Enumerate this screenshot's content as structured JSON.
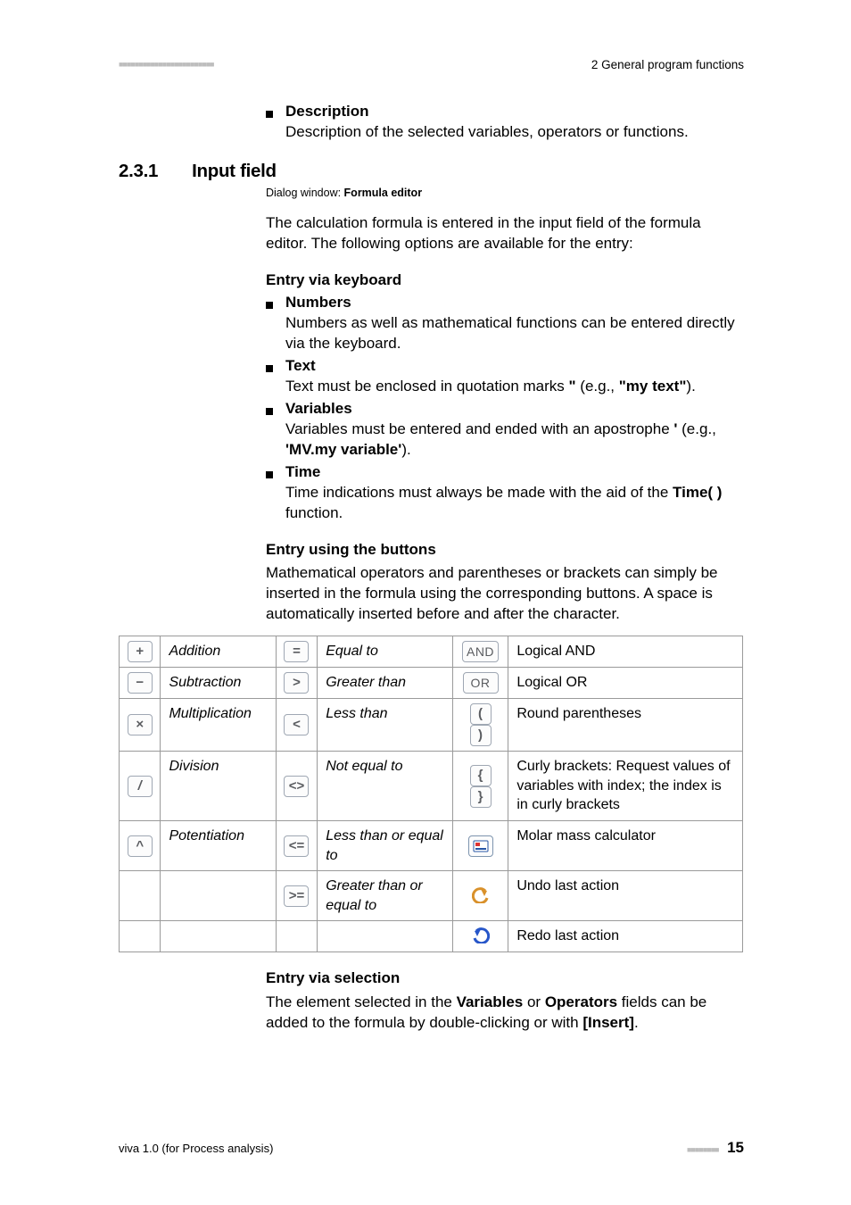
{
  "top_dots": "■■■■■■■■■■■■■■■■■■■■■■■■",
  "top_right": "2 General program functions",
  "description": {
    "label": "Description",
    "body": "Description of the selected variables, operators or functions."
  },
  "section": {
    "num": "2.3.1",
    "title": "Input field"
  },
  "dialog": {
    "prefix": "Dialog window: ",
    "name": "Formula editor"
  },
  "intro_para": "The calculation formula is entered in the input field of the formula editor. The following options are available for the entry:",
  "kb": {
    "heading": "Entry via keyboard",
    "numbers_label": "Numbers",
    "numbers_body": "Numbers as well as mathematical functions can be entered directly via the keyboard.",
    "text_label": "Text",
    "text_pre": "Text must be enclosed in quotation marks ",
    "text_quote": "\"",
    "text_eg_open": " (e.g., ",
    "text_example": "\"my text\"",
    "text_eg_close": ").",
    "vars_label": "Variables",
    "vars_pre": "Variables must be entered and ended with an apostrophe ",
    "vars_apos": "'",
    "vars_eg_open": " (e.g., ",
    "vars_example": "'MV.my variable'",
    "vars_eg_close": ").",
    "time_label": "Time",
    "time_pre": "Time indications must always be made with the aid of the ",
    "time_func": "Time( )",
    "time_post": " function."
  },
  "btns": {
    "heading": "Entry using the buttons",
    "para": "Mathematical operators and parentheses or brackets can simply be inserted in the formula using the corresponding buttons. A space is automatically inserted before and after the character."
  },
  "ops": {
    "r1": {
      "sym1": "+",
      "name1": "Addition",
      "sym2": "=",
      "name2": "Equal to",
      "sym3": "AND",
      "name3": "Logical AND"
    },
    "r2": {
      "sym1": "−",
      "name1": "Subtraction",
      "sym2": ">",
      "name2": "Greater than",
      "sym3": "OR",
      "name3": "Logical OR"
    },
    "r3": {
      "sym1": "×",
      "name1": "Multiplication",
      "sym2": "<",
      "name2": "Less than",
      "sym3a": "(",
      "sym3b": ")",
      "name3": "Round parentheses"
    },
    "r4": {
      "sym1": "/",
      "name1": "Division",
      "sym2": "<>",
      "name2": "Not equal to",
      "sym3a": "{",
      "sym3b": "}",
      "name3": "Curly brackets: Request values of variables with index; the index is in curly brackets"
    },
    "r5": {
      "sym1": "^",
      "name1": "Potentiation",
      "sym2": "<=",
      "name2": "Less than or equal to",
      "name3": "Molar mass calculator"
    },
    "r6": {
      "sym2": ">=",
      "name2": "Greater than or equal to",
      "name3": "Undo last action"
    },
    "r7": {
      "name3": "Redo last action"
    }
  },
  "sel": {
    "heading": "Entry via selection",
    "pre": "The element selected in the ",
    "vars": "Variables",
    "or": " or ",
    "ops": "Operators",
    "mid": " fields can be added to the formula by double-clicking or with ",
    "insert": "[Insert]",
    "end": "."
  },
  "footer": {
    "left": "viva 1.0 (for Process analysis)",
    "dots": "■■■■■■■■",
    "page": "15"
  }
}
